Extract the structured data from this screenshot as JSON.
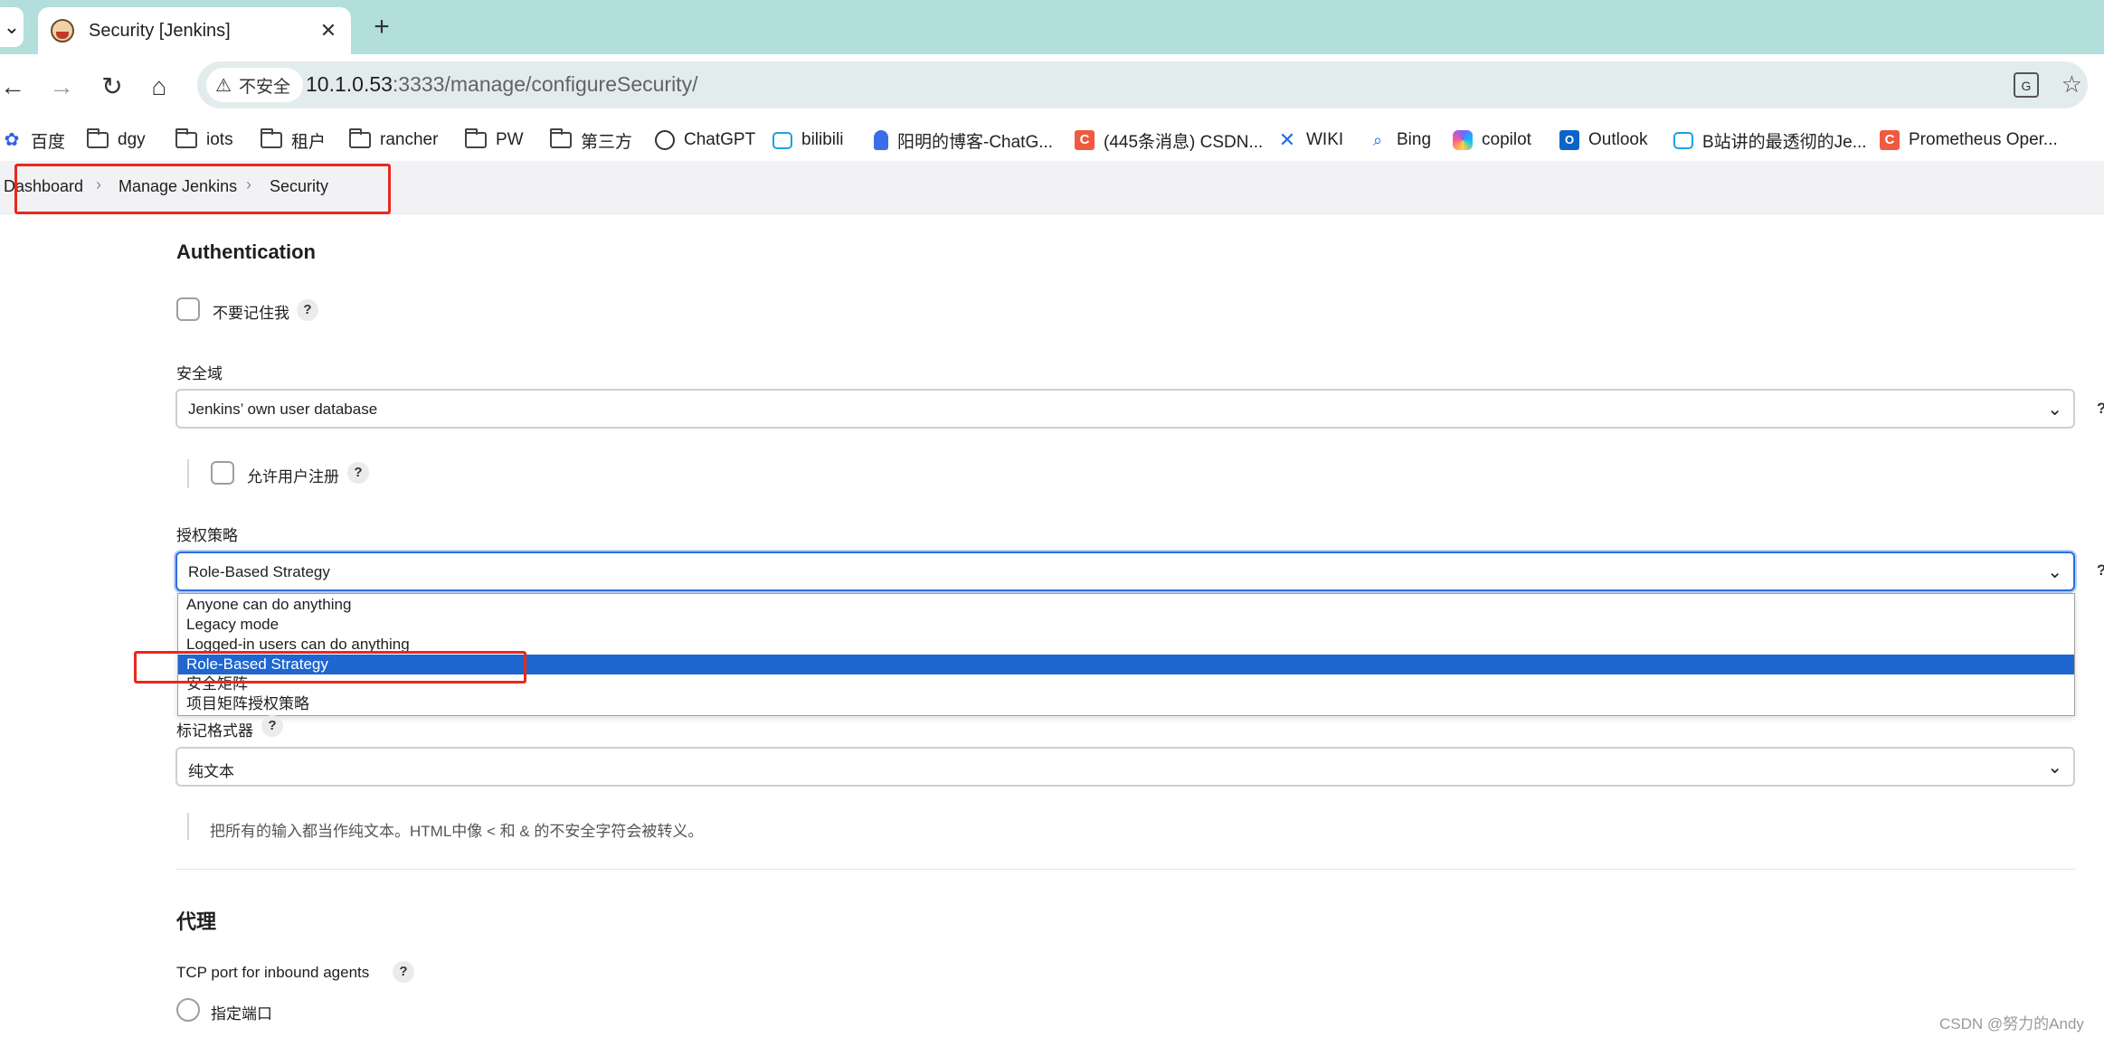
{
  "browser": {
    "tab_title": "Security [Jenkins]",
    "tab_close": "✕",
    "new_tab": "+",
    "menu": "⌄",
    "security_label": "不安全",
    "url_host": "10.1.0.53",
    "url_rest": ":3333/manage/configureSecurity/",
    "bookmarks": [
      "百度",
      "dgy",
      "iots",
      "租户",
      "rancher",
      "PW",
      "第三方",
      "ChatGPT",
      "bilibili",
      "阳明的博客-ChatG...",
      "(445条消息) CSDN...",
      "WIKI",
      "Bing",
      "copilot",
      "Outlook",
      "B站讲的最透彻的Je...",
      "Prometheus Oper..."
    ]
  },
  "breadcrumb": [
    "Dashboard",
    "Manage Jenkins",
    "Security"
  ],
  "authentication": {
    "heading": "Authentication",
    "remember_me_label": "不要记住我",
    "realm_label": "安全域",
    "realm_value": "Jenkins’ own user database",
    "allow_signup_label": "允许用户注册",
    "authz_label": "授权策略",
    "authz_value": "Role-Based Strategy",
    "authz_options": [
      "Anyone can do anything",
      "Legacy mode",
      "Logged-in users can do anything",
      "Role-Based Strategy",
      "安全矩阵",
      "项目矩阵授权策略"
    ],
    "authz_selected_index": 3
  },
  "markup": {
    "label": "标记格式器",
    "value": "纯文本",
    "description": "把所有的输入都当作纯文本。HTML中像 < 和 & 的不安全字符会被转义。"
  },
  "proxy": {
    "heading": "代理",
    "tcp_label": "TCP port for inbound agents",
    "fixed_port_label": "指定端口"
  },
  "help_glyph": "?",
  "watermark": "CSDN @努力的Andy",
  "colors": {
    "accent": "#1e66d0",
    "annotation": "#e8281e",
    "tabbar": "#b2dfdc"
  }
}
